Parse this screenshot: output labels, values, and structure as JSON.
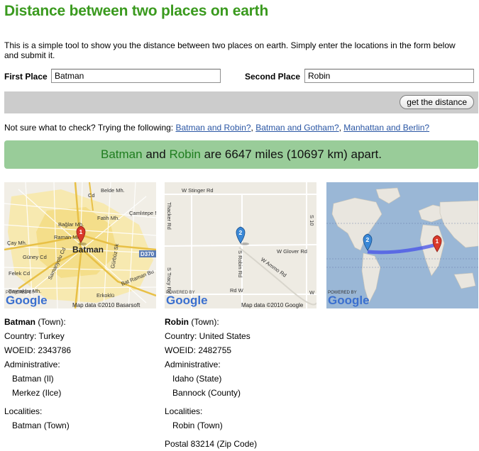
{
  "page": {
    "title": "Distance between two places on earth",
    "intro": "This is a simple tool to show you the distance between two places on earth. Simply enter the locations in the form below and submit it."
  },
  "form": {
    "first_label": "First Place",
    "first_value": "Batman",
    "second_label": "Second Place",
    "second_value": "Robin",
    "submit_label": "get the distance"
  },
  "suggestions": {
    "prefix": "Not sure what to check? Trying the following:",
    "links": [
      "Batman and Robin?",
      "Batman and Gotham?",
      "Manhattan and Berlin?"
    ]
  },
  "result": {
    "place_a": "Batman",
    "and": "and",
    "place_b": "Robin",
    "text": "are 6647 miles (10697 km) apart."
  },
  "maps": {
    "map1": {
      "streets": [
        "Belde Mh.",
        "Bağlar Mh.",
        "Fatih Mh.",
        "Çamlıtepe Mh.",
        "Raman Mh.",
        "Çay Mh.",
        "Batman",
        "Güney Cd",
        "Felek Cd",
        "Bayraklar Mh.",
        "Erkoklü",
        "Bat Raman Bu",
        "D370",
        "Gürbüz Sk",
        "Samanyolu Cd",
        "Cd"
      ],
      "marker": "1",
      "attribution": "Map data ©2010 Basarsoft"
    },
    "map2": {
      "streets": [
        "W Stinger Rd",
        "Thacker Rd",
        "W Glover Rd",
        "S Robin Rd",
        "W Ammo Rd",
        "S Tracy Rd",
        "Rd W",
        "S 10",
        "W"
      ],
      "marker": "2",
      "attribution": "Map data ©2010 Google"
    },
    "map3": {
      "markers": [
        "2",
        "1"
      ]
    },
    "powered_by": "POWERED BY",
    "google": "Google"
  },
  "place1": {
    "name": "Batman",
    "type": "(Town):",
    "country": "Country: Turkey",
    "woeid": "WOEID: 2343786",
    "admin_label": "Administrative:",
    "admin": [
      "Batman (Il)",
      "Merkez (Ilce)"
    ],
    "localities_label": "Localities:",
    "localities": [
      "Batman (Town)"
    ]
  },
  "place2": {
    "name": "Robin",
    "type": "(Town):",
    "country": "Country: United States",
    "woeid": "WOEID: 2482755",
    "admin_label": "Administrative:",
    "admin": [
      "Idaho (State)",
      "Bannock (County)"
    ],
    "localities_label": "Localities:",
    "localities": [
      "Robin (Town)"
    ],
    "postal": "Postal 83214 (Zip Code)"
  },
  "colors": {
    "title_green": "#3a9a1e",
    "result_bg": "#99cc99",
    "link_blue": "#2a56a4",
    "marker_red": "#d9392b",
    "marker_blue": "#3a88d6"
  }
}
